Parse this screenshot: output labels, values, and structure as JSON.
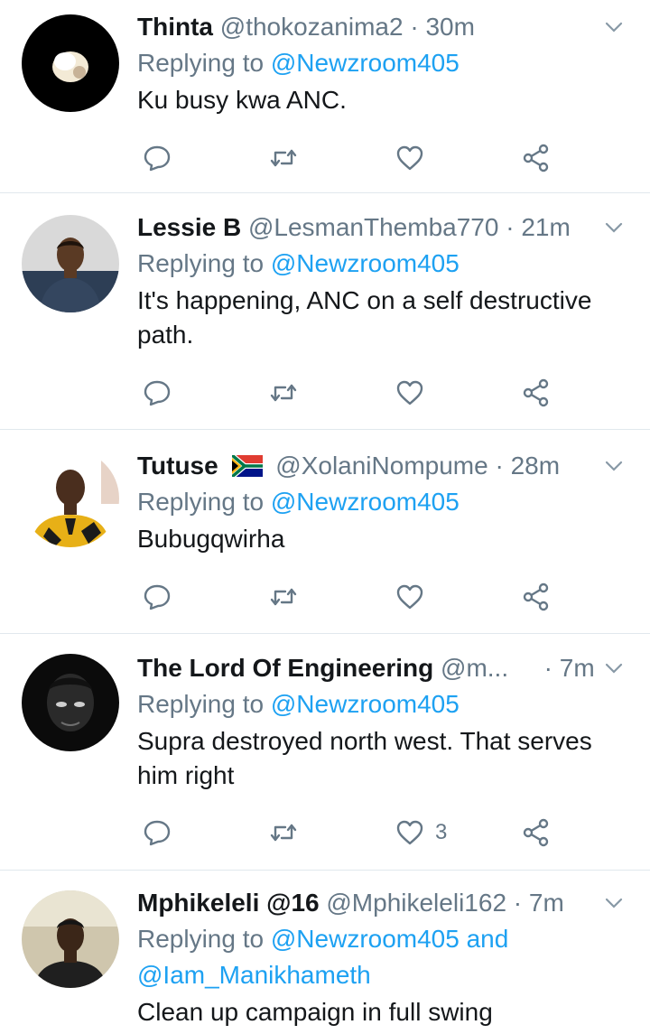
{
  "tweets": [
    {
      "name": "Thinta",
      "handle": "@thokozanima2",
      "time": "30m",
      "replying_prefix": "Replying to",
      "replying_to": "@Newzroom405",
      "text": "Ku busy kwa ANC.",
      "like_count": ""
    },
    {
      "name": "Lessie B",
      "handle": "@LesmanThemba770",
      "time": "21m",
      "replying_prefix": "Replying to",
      "replying_to": "@Newzroom405",
      "text": "It's happening, ANC on a self destructive path.",
      "like_count": ""
    },
    {
      "name": "Tutuse",
      "handle": "@XolaniNompume",
      "time": "28m",
      "replying_prefix": "Replying to",
      "replying_to": "@Newzroom405",
      "text": "Bubugqwirha",
      "like_count": ""
    },
    {
      "name": "The Lord Of Engineering",
      "handle": "@m...",
      "time": "7m",
      "replying_prefix": "Replying to",
      "replying_to": "@Newzroom405",
      "text": "Supra destroyed north west. That serves him right",
      "like_count": "3"
    },
    {
      "name": "Mphikeleli @16",
      "handle": "@Mphikeleli162",
      "time": "7m",
      "replying_prefix": "Replying to",
      "replying_to": "@Newzroom405",
      "replying_and": "and",
      "replying_to_2": "@Iam_Manikhameth",
      "text": "Clean up campaign in full swing",
      "like_count": ""
    }
  ],
  "separator": "·",
  "icons": {
    "reply": "reply-icon",
    "retweet": "retweet-icon",
    "like": "heart-icon",
    "share": "share-icon",
    "more": "chevron-down-icon"
  },
  "colors": {
    "link": "#1da1f2",
    "secondary_text": "#657786",
    "divider": "#e1e8ed"
  }
}
